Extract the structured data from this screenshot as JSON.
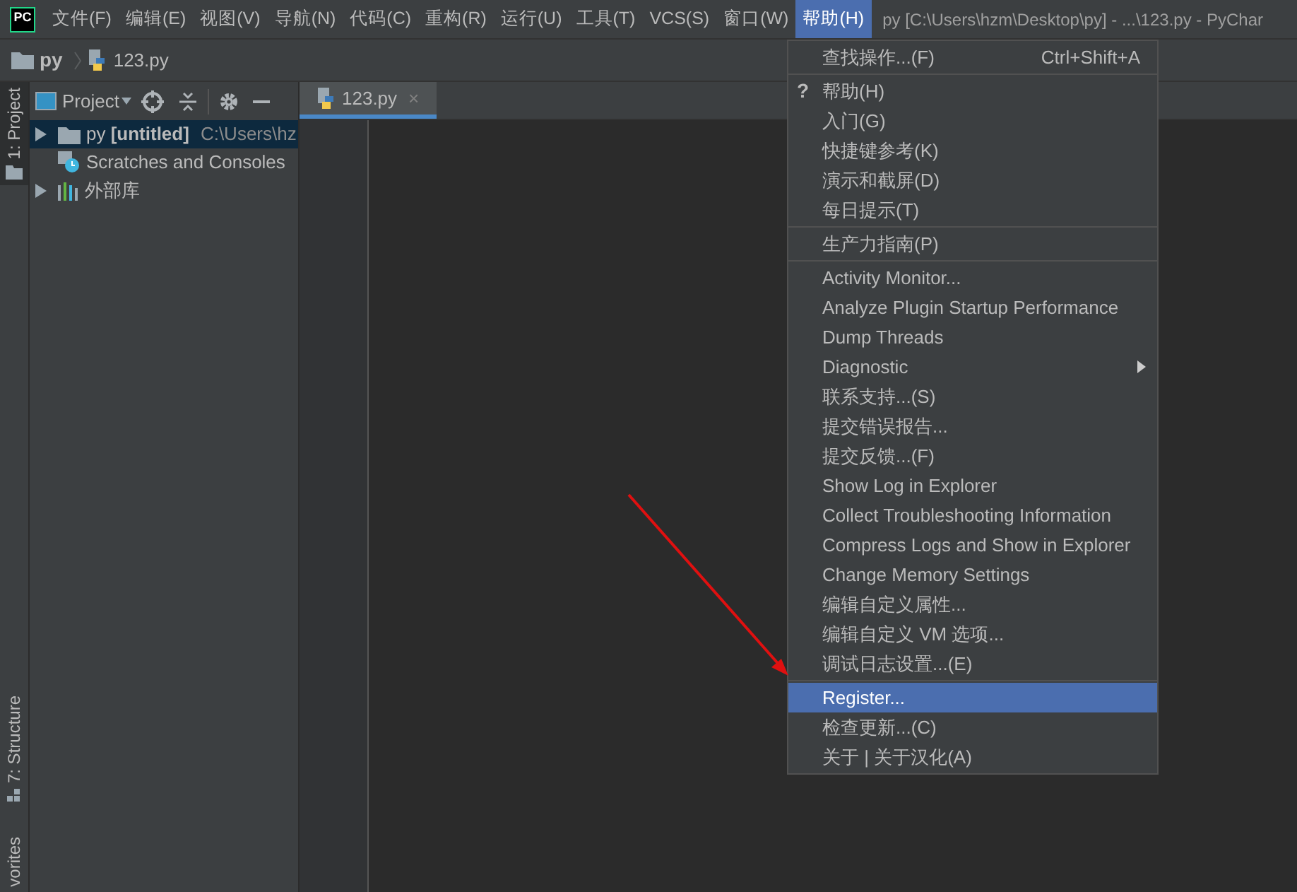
{
  "logo": {
    "text": "PC"
  },
  "menubar": [
    {
      "label": "文件(F)",
      "selected": false
    },
    {
      "label": "编辑(E)",
      "selected": false
    },
    {
      "label": "视图(V)",
      "selected": false
    },
    {
      "label": "导航(N)",
      "selected": false
    },
    {
      "label": "代码(C)",
      "selected": false
    },
    {
      "label": "重构(R)",
      "selected": false
    },
    {
      "label": "运行(U)",
      "selected": false
    },
    {
      "label": "工具(T)",
      "selected": false
    },
    {
      "label": "VCS(S)",
      "selected": false
    },
    {
      "label": "窗口(W)",
      "selected": false
    },
    {
      "label": "帮助(H)",
      "selected": true
    }
  ],
  "window": {
    "title": "py [C:\\Users\\hzm\\Desktop\\py] - ...\\123.py - PyChar"
  },
  "breadcrumb": [
    {
      "label": "py",
      "kind": "folder"
    },
    {
      "label": "123.py",
      "kind": "file"
    }
  ],
  "side_strip": {
    "top": [
      {
        "label": "1: Project",
        "selected": true
      }
    ],
    "bottom": [
      {
        "label": "7: Structure",
        "selected": false
      },
      {
        "label": "vorites",
        "selected": false
      }
    ]
  },
  "project_panel": {
    "title": "Project",
    "tree": [
      {
        "label": "py",
        "bold_label": "[untitled]",
        "path": "C:\\Users\\hz",
        "kind": "folder",
        "expanded": false,
        "selected": true
      },
      {
        "label": "Scratches and Consoles",
        "kind": "scratches",
        "selected": false
      },
      {
        "label": "外部库",
        "kind": "library",
        "expanded": false,
        "selected": false
      }
    ]
  },
  "editor_tabs": [
    {
      "label": "123.py",
      "selected": true,
      "close": "×"
    }
  ],
  "help_menu": {
    "sections": [
      [
        {
          "label": "查找操作...(F)",
          "shortcut": "Ctrl+Shift+A",
          "kind": "item",
          "selected": false
        }
      ],
      [
        {
          "label": "帮助(H)",
          "icon": "?",
          "kind": "item",
          "selected": false
        },
        {
          "label": "入门(G)",
          "kind": "item",
          "selected": false
        },
        {
          "label": "快捷键参考(K)",
          "kind": "item",
          "selected": false
        },
        {
          "label": "演示和截屏(D)",
          "kind": "item",
          "selected": false
        },
        {
          "label": "每日提示(T)",
          "kind": "item",
          "selected": false
        }
      ],
      [
        {
          "label": "生产力指南(P)",
          "kind": "item",
          "selected": false
        }
      ],
      [
        {
          "label": "Activity Monitor...",
          "kind": "item",
          "selected": false
        },
        {
          "label": "Analyze Plugin Startup Performance",
          "kind": "item",
          "selected": false
        },
        {
          "label": "Dump Threads",
          "kind": "item",
          "selected": false
        },
        {
          "label": "Diagnostic",
          "kind": "submenu",
          "selected": false
        },
        {
          "label": "联系支持...(S)",
          "kind": "item",
          "selected": false
        },
        {
          "label": "提交错误报告...",
          "kind": "item",
          "selected": false
        },
        {
          "label": "提交反馈...(F)",
          "kind": "item",
          "selected": false
        },
        {
          "label": "Show Log in Explorer",
          "kind": "item",
          "selected": false
        },
        {
          "label": "Collect Troubleshooting Information",
          "kind": "item",
          "selected": false
        },
        {
          "label": "Compress Logs and Show in Explorer",
          "kind": "item",
          "selected": false
        },
        {
          "label": "Change Memory Settings",
          "kind": "item",
          "selected": false
        },
        {
          "label": "编辑自定义属性...",
          "kind": "item",
          "selected": false
        },
        {
          "label": "编辑自定义 VM 选项...",
          "kind": "item",
          "selected": false
        },
        {
          "label": "调试日志设置...(E)",
          "kind": "item",
          "selected": false
        }
      ],
      [
        {
          "label": "Register...",
          "kind": "item",
          "selected": true
        },
        {
          "label": "检查更新...(C)",
          "kind": "item",
          "selected": false
        },
        {
          "label": "关于 | 关于汉化(A)",
          "kind": "item",
          "selected": false
        }
      ]
    ]
  }
}
